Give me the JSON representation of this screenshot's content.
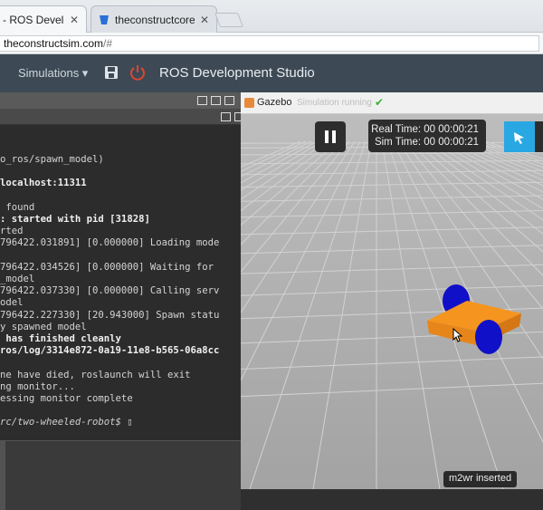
{
  "browser": {
    "tabs": [
      {
        "title": "- ROS Develop",
        "active": true
      },
      {
        "title": "theconstructcore /",
        "active": false
      }
    ],
    "url_host": "theconstructsim.com",
    "url_path": "/#"
  },
  "navbar": {
    "simulations_label": "Simulations ▾",
    "save_icon": "save-icon",
    "power_icon": "power-icon",
    "title": "ROS Development Studio"
  },
  "terminal": {
    "lines": [
      {
        "text": "o_ros/spawn_model)",
        "style": ""
      },
      {
        "text": "",
        "style": ""
      },
      {
        "text": "localhost:11311",
        "style": "b"
      },
      {
        "text": "",
        "style": ""
      },
      {
        "text": " found",
        "style": ""
      },
      {
        "text": ": started with pid [31828]",
        "style": "b"
      },
      {
        "text": "rted",
        "style": ""
      },
      {
        "text": "796422.031891] [0.000000] Loading mode",
        "style": ""
      },
      {
        "text": "",
        "style": ""
      },
      {
        "text": "796422.034526] [0.000000] Waiting for",
        "style": ""
      },
      {
        "text": "_model",
        "style": ""
      },
      {
        "text": "796422.037330] [0.000000] Calling serv",
        "style": ""
      },
      {
        "text": "odel",
        "style": ""
      },
      {
        "text": "796422.227330] [20.943000] Spawn statu",
        "style": ""
      },
      {
        "text": "y spawned model",
        "style": ""
      },
      {
        "text": " has finished cleanly",
        "style": "b"
      },
      {
        "text": "ros/log/3314e872-0a19-11e8-b565-06a8cc",
        "style": "b"
      },
      {
        "text": "",
        "style": ""
      },
      {
        "text": "ne have died, roslaunch will exit",
        "style": ""
      },
      {
        "text": "ng monitor...",
        "style": ""
      },
      {
        "text": "essing monitor complete",
        "style": ""
      },
      {
        "text": "",
        "style": ""
      },
      {
        "text": "rc/two-wheeled-robot$ ▯",
        "style": "p"
      }
    ]
  },
  "gazebo": {
    "title": "Gazebo",
    "status": "Simulation running",
    "status_icon": "check-icon",
    "real_time": "Real Time: 00 00:00:21",
    "sim_time": "Sim Time: 00 00:00:21",
    "insert_message": "m2wr inserted",
    "colors": {
      "robot_body": "#f5951f",
      "robot_wheels": "#1010c8",
      "ground": "#a5a5a5",
      "tool_button": "#29a7e3"
    }
  }
}
